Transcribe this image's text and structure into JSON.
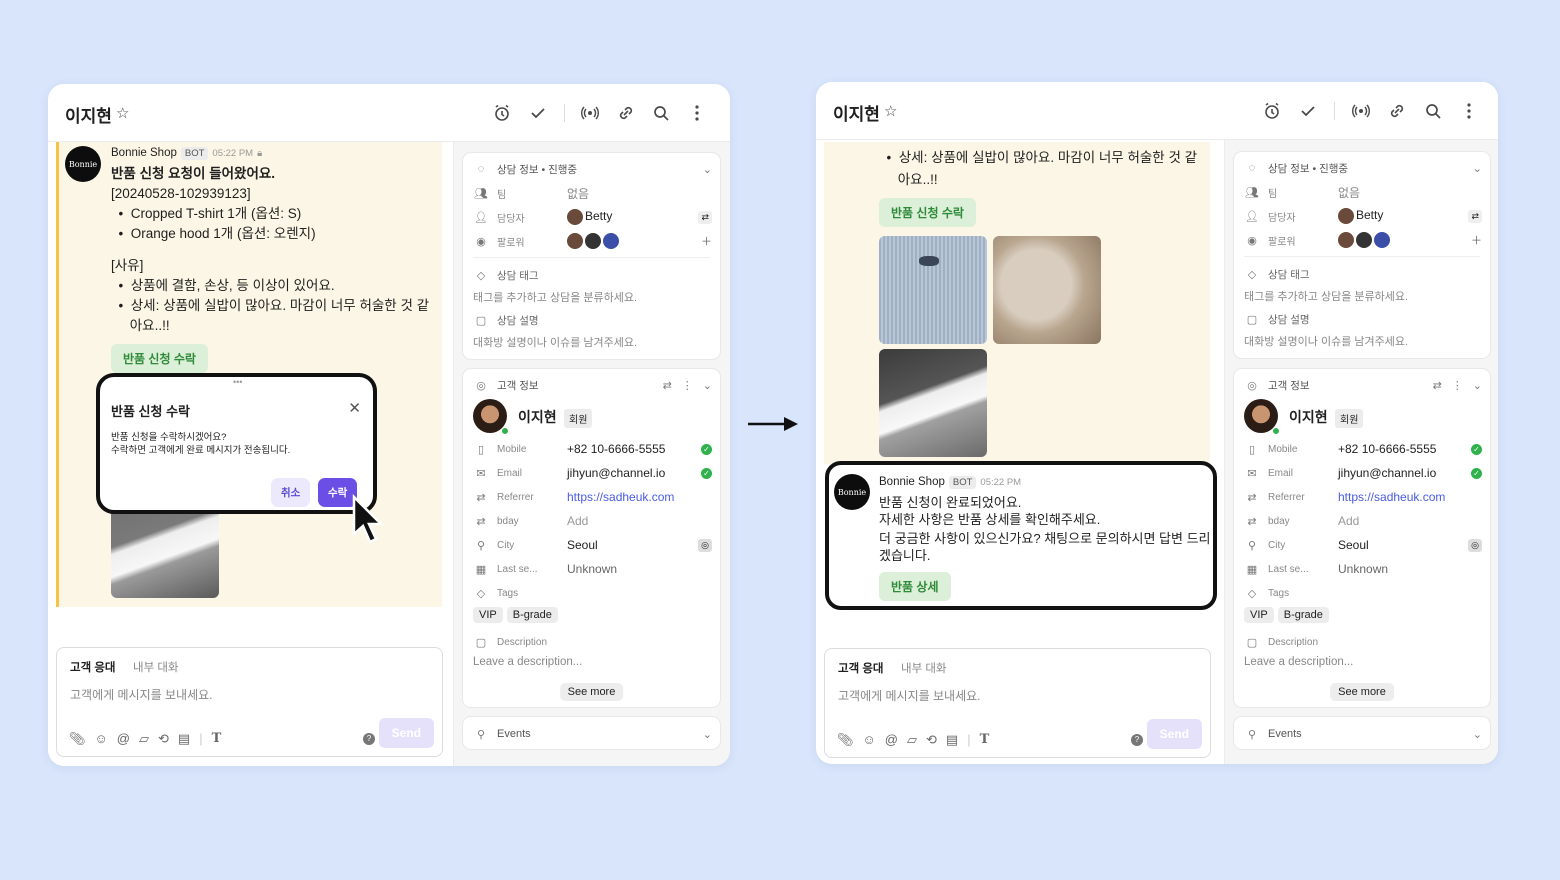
{
  "left": {
    "header": {
      "name": "이지현",
      "star_icon": "star-icon"
    },
    "message": {
      "sender": "Bonnie Shop",
      "bot": "BOT",
      "time": "05:22 PM",
      "avatar_text": "Bonnie",
      "title": "반품 신청 요청이 들어왔어요.",
      "lines": [
        "[20240528-102939123]",
        "  •  Cropped T-shirt 1개 (옵션: S)",
        "  •  Orange hood 1개 (옵션: 오렌지)",
        "",
        "[사유]",
        "  •  상품에 결함, 손상, 등 이상이 있어요.",
        "  •  상세: 상품에 실밥이 많아요. 마감이 너무 허술한 것 같",
        "     아요..!!"
      ],
      "button": "반품 신청 수락"
    },
    "modal": {
      "title": "반품 신청 수락",
      "body": "반품 신청을 수락하시겠어요?\n수락하면 고객에게 완료 메시지가 전송됩니다.",
      "cancel": "취소",
      "ok": "수락"
    }
  },
  "right": {
    "header": {
      "name": "이지현"
    },
    "message_top": [
      "  •  상세: 상품에 실밥이 많아요. 마감이 너무 허술한 것 같",
      "     아요..!!"
    ],
    "button": "반품 신청 수락",
    "reply": {
      "sender": "Bonnie Shop",
      "bot": "BOT",
      "time": "05:22 PM",
      "body": "반품 신청이 완료되었어요.\n자세한 사항은 반품 상세를 확인해주세요.",
      "body2": "더 궁금한 사항이 있으신가요? 채팅으로 문의하시면 답변 드리\n겠습니다.",
      "button": "반품 상세"
    }
  },
  "composer": {
    "tab_active": "고객 응대",
    "tab_inactive": "내부 대화",
    "placeholder": "고객에게 메시지를 보내세요.",
    "send": "Send",
    "help": "?"
  },
  "info_card": {
    "title": "상담 정보 • 진행중",
    "team_label": "팀",
    "team_value": "없음",
    "assignee_label": "담당자",
    "assignee_value": "Betty",
    "followers_label": "팔로워",
    "tags_label": "상담 태그",
    "tags_placeholder": "태그를 추가하고 상담을 분류하세요.",
    "desc_label": "상담 설명",
    "desc_placeholder": "대화방 설명이나 이슈를 남겨주세요."
  },
  "customer_card": {
    "title": "고객 정보",
    "name": "이지현",
    "badge": "회원",
    "mobile_label": "Mobile",
    "mobile": "+82 10-6666-5555",
    "email_label": "Email",
    "email": "jihyun@channel.io",
    "referrer_label": "Referrer",
    "referrer": "https://sadheuk.com",
    "bday_label": "bday",
    "bday": "Add",
    "city_label": "City",
    "city": "Seoul",
    "last_label": "Last se...",
    "last": "Unknown",
    "tags_label": "Tags",
    "tags": [
      "VIP",
      "B-grade"
    ],
    "desc_label": "Description",
    "desc_placeholder": "Leave a description...",
    "see_more": "See more"
  },
  "events": {
    "label": "Events"
  },
  "colors": {
    "accent": "#6b4ee6",
    "link": "#4a5be0",
    "green": "#2fb14b",
    "bg": "#d8e5fb"
  }
}
